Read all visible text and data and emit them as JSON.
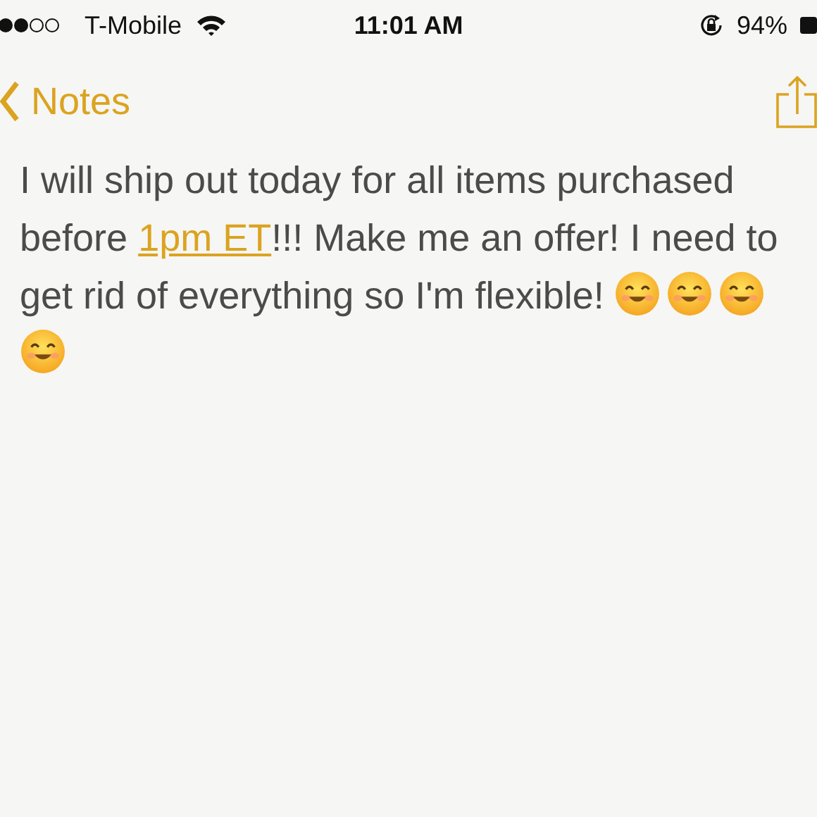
{
  "status_bar": {
    "carrier": "T-Mobile",
    "time": "11:01 AM",
    "battery": "94%"
  },
  "nav": {
    "back_label": "Notes"
  },
  "note": {
    "parts": [
      {
        "kind": "text",
        "text": "I will ship out today for all items purchased before "
      },
      {
        "kind": "link",
        "text": "1pm ET"
      },
      {
        "kind": "text",
        "text": "!!! Make me an offer! I need to get rid of everything so I'm flexible! "
      }
    ],
    "icons": [
      {
        "kind": "smiley"
      },
      {
        "kind": "smiley"
      },
      {
        "kind": "smiley"
      },
      {
        "kind": "smiley"
      }
    ]
  }
}
